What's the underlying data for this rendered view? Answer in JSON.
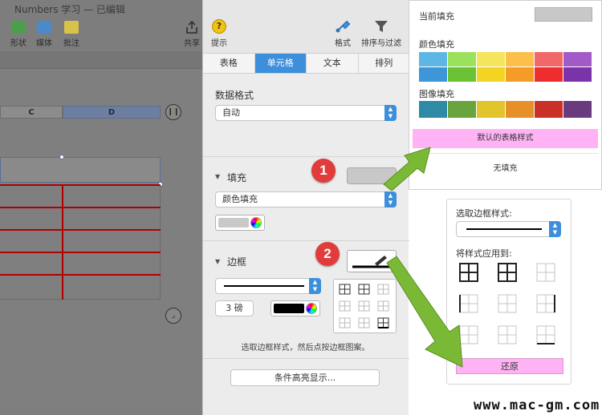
{
  "window": {
    "title": "Numbers 学习 — 已编辑",
    "toolbar": {
      "items": [
        {
          "label": "形状",
          "icon": "shape-icon",
          "color": "#4aa04a"
        },
        {
          "label": "媒体",
          "icon": "media-icon",
          "color": "#4a8acb"
        },
        {
          "label": "批注",
          "icon": "comment-icon",
          "color": "#d8c34a"
        }
      ],
      "share_label": "共享"
    },
    "grid": {
      "column_headers": [
        "C",
        "D"
      ]
    }
  },
  "inspector": {
    "tips_label": "提示",
    "format_label": "格式",
    "sort_filter_label": "排序与过滤",
    "tabs": [
      {
        "label": "表格",
        "active": false
      },
      {
        "label": "单元格",
        "active": true
      },
      {
        "label": "文本",
        "active": false
      },
      {
        "label": "排列",
        "active": false
      }
    ],
    "data_format": {
      "label": "数据格式",
      "value": "自动"
    },
    "fill": {
      "label": "填充",
      "type_value": "颜色填充",
      "swatch_color": "#c8c8c8"
    },
    "border": {
      "label": "边框",
      "width_value": "3 磅",
      "swatch_color": "#000000"
    },
    "border_hint": "选取边框样式，然后点按边框图案。",
    "conditional_button": "条件高亮显示..."
  },
  "callouts": [
    {
      "number": "1"
    },
    {
      "number": "2"
    }
  ],
  "fill_popover": {
    "current_fill_label": "当前填充",
    "current_fill_color": "#c8c8c8",
    "color_fill_label": "颜色填充",
    "color_rows": [
      [
        "#5eb6e6",
        "#9be25c",
        "#f4e55c",
        "#fbbf4a",
        "#f26767",
        "#a35ac9"
      ],
      [
        "#3c96d8",
        "#6ac234",
        "#f2d422",
        "#f59c28",
        "#ee2e2e",
        "#7a33a8"
      ]
    ],
    "image_fill_label": "图像填充",
    "image_colors": [
      "#2f8aa5",
      "#6aa43f",
      "#e1c52a",
      "#e79028",
      "#c93028",
      "#6a3a7f"
    ],
    "default_style_button": "默认的表格样式",
    "no_fill_button": "无填充",
    "button_highlight": "#ffb3f4"
  },
  "border_popover": {
    "style_label": "选取边框样式:",
    "apply_label": "将样式应用到:",
    "restore_button": "还原"
  },
  "watermark": "www.mac-gm.com",
  "accent": "#3d8fdb",
  "arrow_color": "#7ab935"
}
